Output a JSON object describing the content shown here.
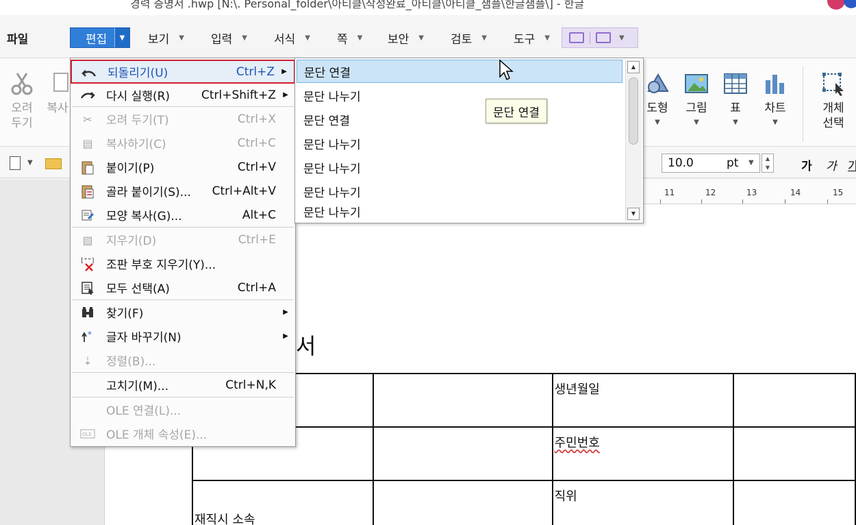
{
  "window": {
    "title": "경력 증명서 .hwp [N:\\. Personal_folder\\아티클\\작성완료_아티클\\아티클_샘플\\한글샘플\\] - 한글"
  },
  "menubar": {
    "file": "파일",
    "edit": "편집",
    "view": "보기",
    "insert": "입력",
    "format": "서식",
    "page": "쪽",
    "security": "보안",
    "review": "검토",
    "tools": "도구"
  },
  "ribbon": {
    "cut": "오려\n두기",
    "copy": "복사",
    "shape": "도형",
    "picture": "그림",
    "table": "표",
    "chart": "차트",
    "select_object": "개체\n선택"
  },
  "toolbar": {
    "font_size": "10.0",
    "font_unit": "pt",
    "bold": "가",
    "italic": "가",
    "underline": "가"
  },
  "ruler": {
    "labels": [
      "11",
      "12",
      "13",
      "14",
      "15"
    ]
  },
  "edit_menu": {
    "items": [
      {
        "label": "되돌리기(U)",
        "shortcut": "Ctrl+Z",
        "submenu": true,
        "enabled": true,
        "highlighted": true,
        "icon": "undo-icon"
      },
      {
        "label": "다시 실행(R)",
        "shortcut": "Ctrl+Shift+Z",
        "submenu": true,
        "enabled": true,
        "icon": "redo-icon"
      },
      {
        "label": "오려 두기(T)",
        "shortcut": "Ctrl+X",
        "enabled": false,
        "icon": "scissors-icon"
      },
      {
        "label": "복사하기(C)",
        "shortcut": "Ctrl+C",
        "enabled": false,
        "icon": "copy-icon"
      },
      {
        "label": "붙이기(P)",
        "shortcut": "Ctrl+V",
        "enabled": true,
        "icon": "paste-icon"
      },
      {
        "label": "골라 붙이기(S)...",
        "shortcut": "Ctrl+Alt+V",
        "enabled": true,
        "icon": "paste-special-icon"
      },
      {
        "label": "모양 복사(G)...",
        "shortcut": "Alt+C",
        "enabled": true,
        "icon": "format-painter-icon"
      },
      {
        "label": "지우기(D)",
        "shortcut": "Ctrl+E",
        "enabled": false,
        "icon": "erase-icon"
      },
      {
        "label": "조판 부호 지우기(Y)...",
        "shortcut": "",
        "enabled": true,
        "icon": "delete-codes-icon"
      },
      {
        "label": "모두 선택(A)",
        "shortcut": "Ctrl+A",
        "enabled": true,
        "icon": "select-all-icon"
      },
      {
        "label": "찾기(F)",
        "shortcut": "",
        "submenu": true,
        "enabled": true,
        "icon": "binoculars-icon"
      },
      {
        "label": "글자 바꾸기(N)",
        "shortcut": "",
        "submenu": true,
        "enabled": true,
        "icon": "replace-icon"
      },
      {
        "label": "정렬(B)...",
        "shortcut": "",
        "enabled": false,
        "icon": "sort-icon"
      },
      {
        "label": "고치기(M)...",
        "shortcut": "Ctrl+N,K",
        "enabled": true,
        "icon": ""
      },
      {
        "label": "OLE 연결(L)...",
        "shortcut": "",
        "enabled": false,
        "icon": ""
      },
      {
        "label": "OLE 개체 속성(E)...",
        "shortcut": "",
        "enabled": false,
        "icon": "ole-icon"
      }
    ]
  },
  "undo_list": {
    "items": [
      "문단 연결",
      "문단 나누기",
      "문단 연결",
      "문단 나누기",
      "문단 나누기",
      "문단 나누기",
      "문단 나누기"
    ],
    "tooltip": "문단 연결"
  },
  "document": {
    "title_fragment": "서",
    "table": {
      "rows": [
        [
          "",
          "",
          "생년월일",
          ""
        ],
        [
          "",
          "",
          "주민번호",
          ""
        ],
        [
          "재직시 소속",
          "",
          "직위",
          ""
        ]
      ]
    }
  }
}
